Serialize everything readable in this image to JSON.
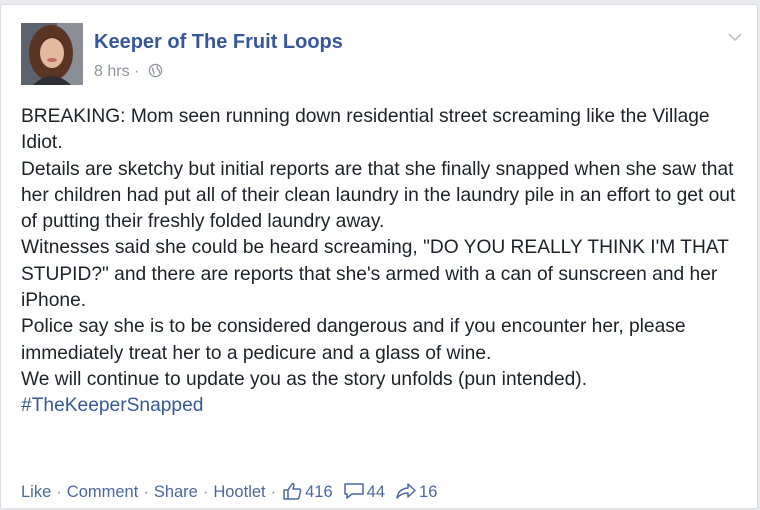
{
  "post": {
    "author": "Keeper of The Fruit Loops",
    "time": "8 hrs",
    "meta_sep": "·",
    "icons": {
      "privacy": "globe-icon",
      "menu": "chevron-down-icon"
    },
    "paragraphs": [
      "BREAKING: Mom seen running down residential street screaming like the Village Idiot.",
      "Details are sketchy but initial reports are that she finally snapped when she saw that her children had put all of their clean laundry in the laundry pile in an effort to get out of putting their freshly folded laundry away.",
      "Witnesses said she could be heard screaming, \"DO YOU REALLY THINK I'M THAT STUPID?\" and there are reports that she's armed with a can of sunscreen and her iPhone.",
      "Police say she is to be considered dangerous and if you encounter her, please immediately treat her to a pedicure and a glass of wine.",
      "We will continue to update you as the story unfolds (pun intended)."
    ],
    "hashtag": "#TheKeeperSnapped"
  },
  "actions": {
    "like": "Like",
    "comment": "Comment",
    "share": "Share",
    "hootlet": "Hootlet",
    "sep": "·",
    "likes_count": "416",
    "comments_count": "44",
    "shares_count": "16"
  },
  "colors": {
    "link": "#365899",
    "meta": "#90949c",
    "text": "#1d2129",
    "action_link": "#4b67a1"
  }
}
